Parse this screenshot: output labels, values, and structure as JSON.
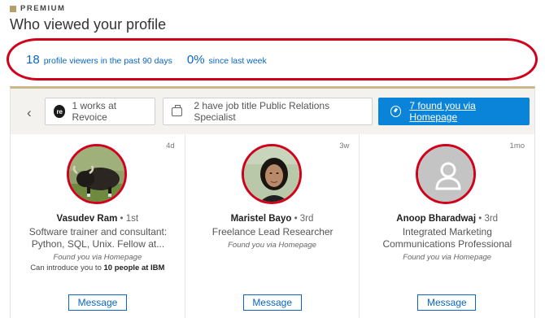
{
  "header": {
    "premium_label": "PREMIUM",
    "title": "Who viewed your profile"
  },
  "stats": {
    "viewers_count": "18",
    "viewers_label": "profile viewers in the past 90 days",
    "change_value": "0%",
    "change_label": "since last week"
  },
  "filters": {
    "chip1_label": "1 works at Revoice",
    "chip1_logo": "re",
    "chip2_label": "2 have job title Public Relations Specialist",
    "chip3_label": "7 found you via Homepage"
  },
  "viewers": [
    {
      "time": "4d",
      "name": "Vasudev Ram",
      "degree": " • 1st",
      "headline": "Software trainer and consultant: Python, SQL, Unix. Fellow at...",
      "found": "Found you via Homepage",
      "intro_prefix": "Can introduce you to ",
      "intro_bold": "10 people at IBM",
      "button": "Message"
    },
    {
      "time": "3w",
      "name": "Maristel Bayo",
      "degree": " • 3rd",
      "headline": "Freelance Lead Researcher",
      "found": "Found you via Homepage",
      "button": "Message"
    },
    {
      "time": "1mo",
      "name": "Anoop Bharadwaj",
      "degree": " • 3rd",
      "headline": "Integrated Marketing Communications Professional",
      "found": "Found you via Homepage",
      "button": "Message"
    }
  ],
  "colors": {
    "accent_blue": "#0a66c2",
    "highlight_red": "#d0021b",
    "premium_gold": "#b49e6a"
  }
}
